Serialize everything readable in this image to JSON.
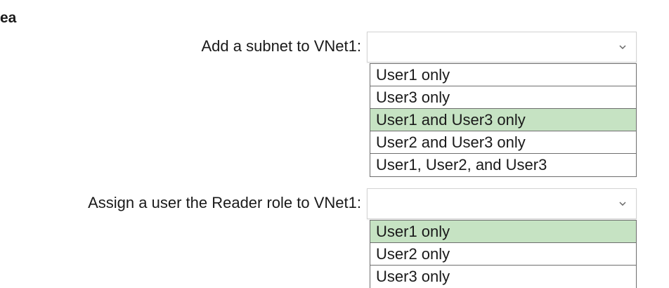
{
  "heading": "ea",
  "questions": [
    {
      "label": "Add a subnet to VNet1:",
      "dropdown_value": "",
      "options": [
        {
          "label": "User1 only",
          "selected": false
        },
        {
          "label": "User3 only",
          "selected": false
        },
        {
          "label": "User1 and User3 only",
          "selected": true
        },
        {
          "label": "User2 and User3 only",
          "selected": false
        },
        {
          "label": "User1, User2, and User3",
          "selected": false
        }
      ]
    },
    {
      "label": "Assign a user the Reader role to VNet1:",
      "dropdown_value": "",
      "options": [
        {
          "label": "User1 only",
          "selected": true
        },
        {
          "label": "User2 only",
          "selected": false
        },
        {
          "label": "User3 only",
          "selected": false
        }
      ]
    }
  ],
  "colors": {
    "selected_option_bg": "#c6e3c3",
    "option_border": "#6e6e6e",
    "select_border": "#d3d3d3"
  },
  "icons": {
    "dropdown": "chevron-down-icon"
  }
}
